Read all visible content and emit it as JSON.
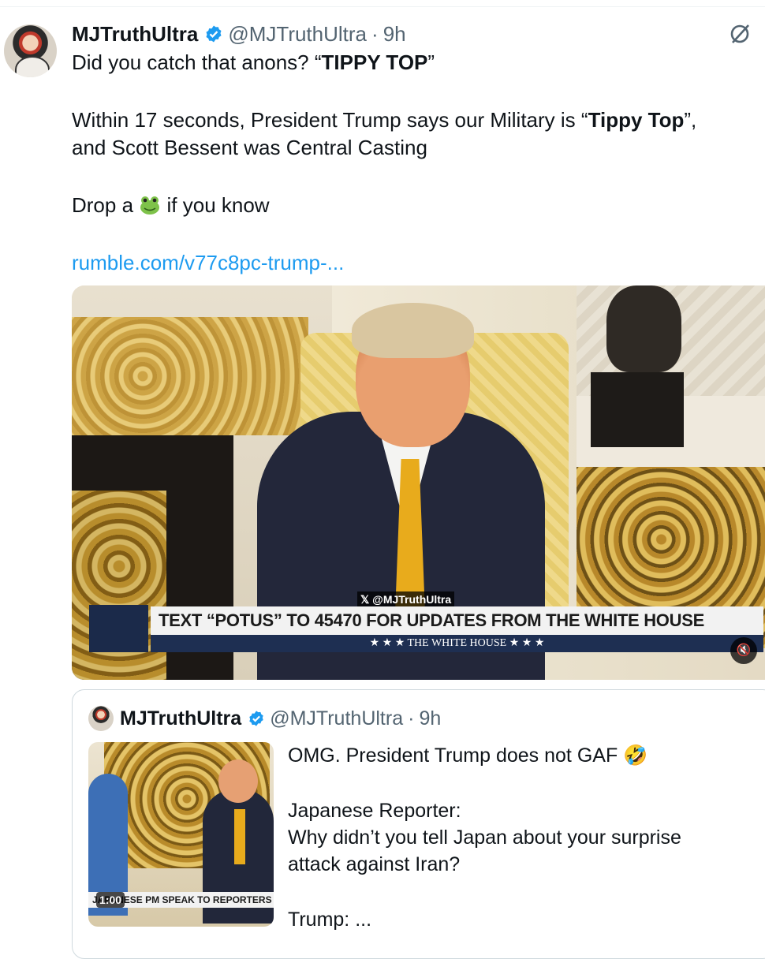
{
  "tweet": {
    "display_name": "MJTruthUltra",
    "handle": "@MJTruthUltra",
    "separator": "·",
    "time": "9h",
    "line1_prefix": "Did you catch that anons? “",
    "line1_bold": "TIPPY TOP",
    "line1_suffix": "”",
    "line2_prefix": "Within 17 seconds, President Trump says our Military is “",
    "line2_bold": "Tippy Top",
    "line2_suffix": "”,",
    "line3": "and Scott Bessent was Central Casting",
    "line4_prefix": "Drop a",
    "line4_suffix": "if you know",
    "link": "rumble.com/v77c8pc-trump-..."
  },
  "video": {
    "watermark": "@MJTruthUltra",
    "chyron_main": "TEXT “POTUS” TO 45470 FOR UPDATES FROM THE WHITE HOUSE",
    "chyron_sub": "★ ★ ★   THE WHITE HOUSE   ★ ★ ★",
    "mute_icon": "speaker-muted-icon"
  },
  "quoted": {
    "display_name": "MJTruthUltra",
    "handle": "@MJTruthUltra",
    "separator": "·",
    "time": "9h",
    "thumb_caption": "JAPANESE PM SPEAK TO REPORTERS",
    "duration": "1:00",
    "line1": "OMG. President Trump does not GAF 🤣",
    "line2": "Japanese Reporter:",
    "line3": "Why didn’t you tell Japan about your surprise",
    "line4": "attack against Iran?",
    "line5": "Trump: ..."
  },
  "colors": {
    "accent": "#1d9bf0",
    "muted": "#536471",
    "border": "#cfd9de"
  }
}
